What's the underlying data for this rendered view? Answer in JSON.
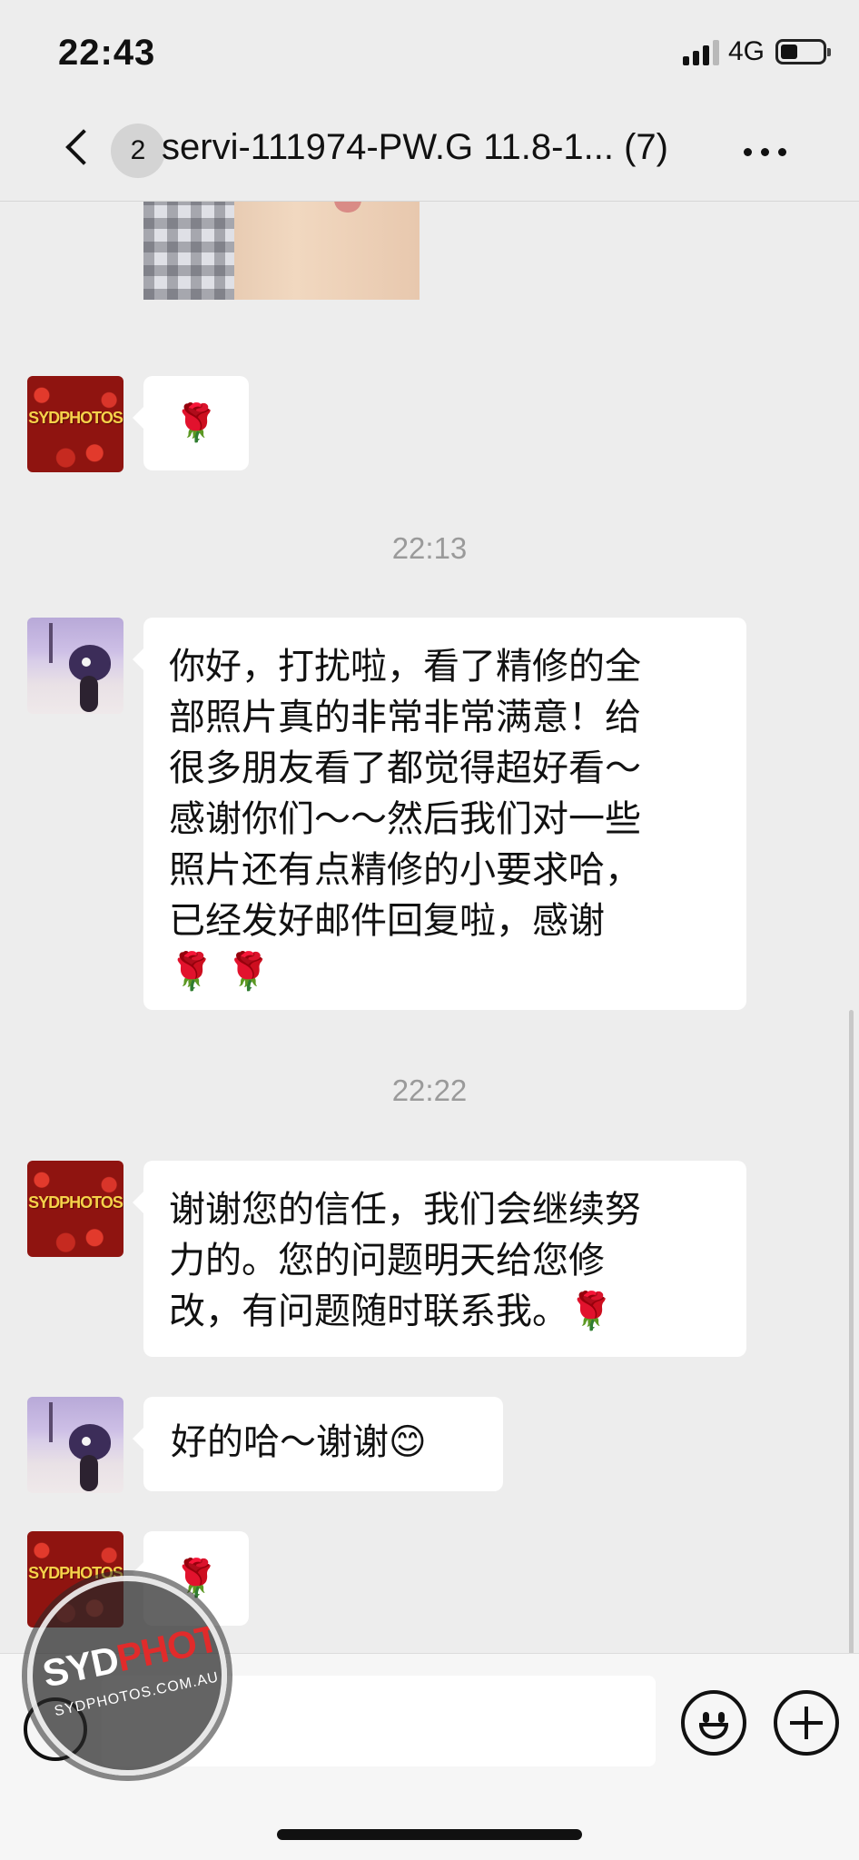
{
  "status_bar": {
    "time": "22:43",
    "network": "4G",
    "battery_level": 0.4,
    "signal_bars": 3
  },
  "nav": {
    "unread_count": "2",
    "title": "servi-111974-PW.G 11.8-1... (7)",
    "icons": [
      "back-icon",
      "more-icon"
    ]
  },
  "messages": {
    "rose_1": "🌹",
    "time_1": "22:13",
    "customer_message_1": "你好，打扰啦，看了精修的全\n部照片真的非常非常满意！给\n很多朋友看了都觉得超好看～\n感谢你们～～然后我们对一些\n照片还有点精修的小要求哈，\n已经发好邮件回复啦，感谢\n🌹 🌹",
    "time_2": "22:22",
    "studio_reply": "谢谢您的信任，我们会继续努\n力的。您的问题明天给您修\n改，有问题随时联系我。🌹",
    "customer_message_2": "好的哈～谢谢😊",
    "rose_2": "🌹",
    "studio_avatar_text": "SYDPHOTOS"
  },
  "input_bar": {
    "placeholder": "",
    "icons": [
      "voice-icon",
      "emoji-icon",
      "plus-icon"
    ]
  },
  "watermark": {
    "logo_a": "SYD",
    "logo_b": "PHOTOS",
    "url": "SYDPHOTOS.COM.AU"
  },
  "colors": {
    "background": "#ededed",
    "bubble": "#ffffff",
    "timestamp": "#9a9a9a",
    "accent_red": "#e12b2b"
  }
}
